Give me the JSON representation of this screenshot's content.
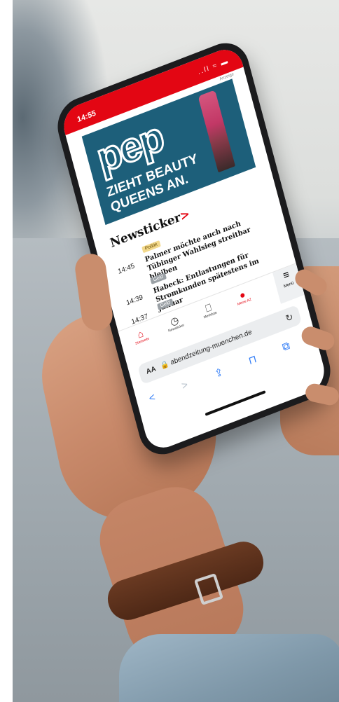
{
  "phone": {
    "time": "14:55",
    "status_icons": "..ll ≈ ▬",
    "ad": {
      "label": "Anzeige",
      "brand": "pep",
      "line1": "ZIEHT BEAUTY",
      "line2": "QUEENS AN."
    },
    "newsticker": {
      "title": "Newsticker",
      "arrow": ">",
      "items": [
        {
          "time": "14:45",
          "tag": "Politik",
          "headline": "Palmer möchte auch nach Tübinger Wahlsieg streitbar bleiben"
        },
        {
          "time": "14:39",
          "tag": "Geld",
          "headline": "Habeck: Entlastungen für Stromkunden spätestens im Januar"
        },
        {
          "time": "14:37",
          "tag": "Geld",
          "headline": ""
        }
      ]
    },
    "nav": [
      {
        "label": "Startseite",
        "icon": "home-icon",
        "glyph": "⌂"
      },
      {
        "label": "Newsticker",
        "icon": "clock-icon",
        "glyph": "◷"
      },
      {
        "label": "Merkliste",
        "icon": "bookmark-icon",
        "glyph": "⎕"
      },
      {
        "label": "Meine AZ",
        "icon": "user-icon",
        "glyph": "●"
      }
    ],
    "menu": {
      "label": "Menü",
      "glyph": "≡"
    },
    "browser": {
      "aa": "AA",
      "url": "🔒 abendzeitung-muenchen.de",
      "reload": "↻",
      "back": "<",
      "forward": ">",
      "share": "⇪",
      "bookmarks": "⊓",
      "tabs": "⧉"
    }
  },
  "colors": {
    "brand_red": "#e30613",
    "ad_background": "#1d5f7a"
  }
}
